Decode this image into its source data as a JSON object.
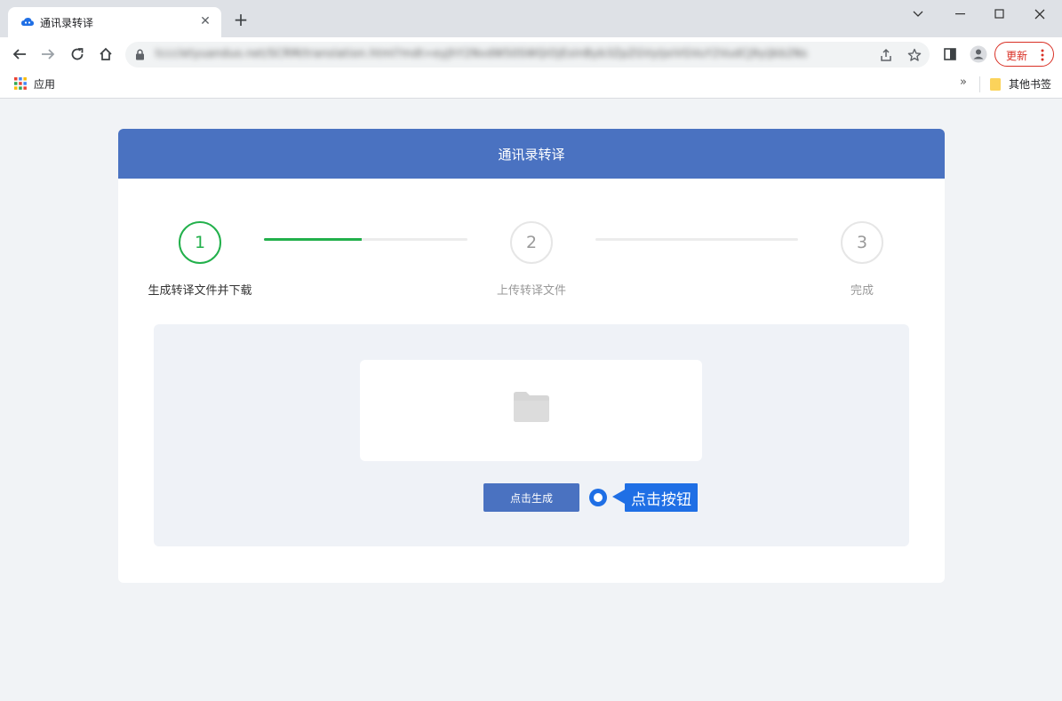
{
  "browser": {
    "tab_title": "通讯录转译",
    "url": "tcccletyuanduo.net/SCRM/translation.html?mdt=eyJhY2NvdW50SWQiOjEsInByb3ZpZGVyIjoiVGVuY2VudCJ9yiJkb2Ns",
    "update_label": "更新",
    "bookmarks": {
      "apps_label": "应用",
      "more_label": "»",
      "other_label": "其他书签"
    }
  },
  "page": {
    "title": "通讯录转译",
    "steps": [
      {
        "number": "1",
        "label": "生成转译文件并下载"
      },
      {
        "number": "2",
        "label": "上传转译文件"
      },
      {
        "number": "3",
        "label": "完成"
      }
    ],
    "progress": {
      "line1_fill_fraction": 0.48,
      "line2_fill_fraction": 0
    },
    "generate_button_label": "点击生成",
    "hint_label": "点击按钮"
  },
  "colors": {
    "header_blue": "#4a72c1",
    "success_green": "#22b04b",
    "hint_blue": "#1f6fe5",
    "update_red": "#d93025"
  }
}
